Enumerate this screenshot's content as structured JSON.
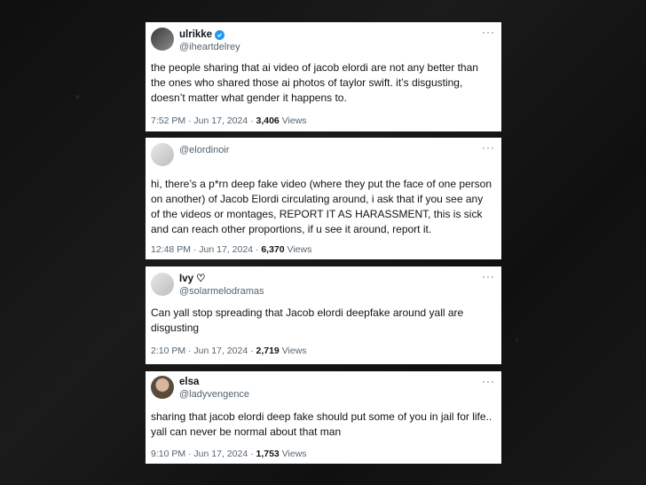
{
  "tweets": [
    {
      "display_name": "ulrikke",
      "handle": "@iheartdelrey",
      "verified": true,
      "text": "the people sharing that ai video of jacob elordi are not any better than the ones who shared those ai photos of taylor swift. it’s disgusting, doesn’t matter what gender it happens to.",
      "time": "7:52 PM · Jun 17, 2024 ·",
      "views_count": "3,406",
      "views_label": "Views",
      "more": "···"
    },
    {
      "display_name": "",
      "handle": "@elordinoir",
      "verified": false,
      "text": "hi, there’s a p*rn deep fake video (where they put the face of one person on another) of Jacob Elordi circulating around, i ask that if you see any of the videos or montages, REPORT IT AS HARASSMENT, this is sick and can reach other proportions, if u see it around, report it.",
      "time": "12:48 PM · Jun 17, 2024 ·",
      "views_count": "6,370",
      "views_label": "Views",
      "more": "···"
    },
    {
      "display_name": "Ivy ♡",
      "handle": "@solarmelodramas",
      "verified": false,
      "text": "Can yall stop spreading that Jacob elordi deepfake around yall are disgusting",
      "time": "2:10 PM · Jun 17, 2024 ·",
      "views_count": "2,719",
      "views_label": "Views",
      "more": "···"
    },
    {
      "display_name": "elsa",
      "handle": "@ladyvengence",
      "verified": false,
      "text": "sharing that jacob elordi deep fake should put some of you in jail for life.. yall can never be normal about that man",
      "time": "9:10 PM · Jun 17, 2024 ·",
      "views_count": "1,753",
      "views_label": "Views",
      "more": "···"
    }
  ],
  "colors": {
    "verified": "#1d9bf0",
    "secondary_text": "#536471",
    "primary_text": "#0f1419"
  }
}
